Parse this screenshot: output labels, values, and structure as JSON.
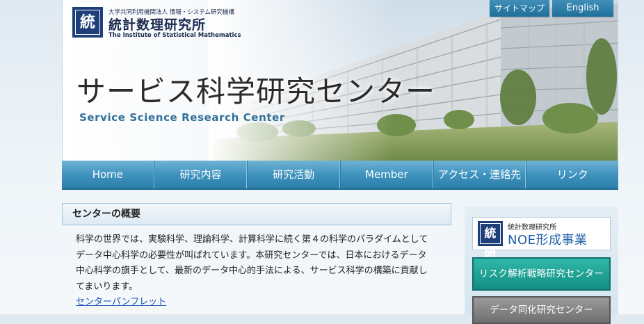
{
  "header": {
    "logo_mark": "統研",
    "logo_sub": "大学共同利用機関法人 情報・システム研究機構",
    "logo_name": "統計数理研究所",
    "logo_en": "The Institute of Statistical Mathematics",
    "title_jp": "サービス科学研究センター",
    "title_en": "Service Science Research Center"
  },
  "util_links": {
    "sitemap": "サイトマップ",
    "english": "English"
  },
  "nav": {
    "items": [
      "Home",
      "研究内容",
      "研究活動",
      "Member",
      "アクセス・連絡先",
      "リンク"
    ]
  },
  "main": {
    "section_title": "センターの概要",
    "body_lines": [
      "科学の世界では、実験科学、理論科学、計算科学に続く第４の科学のパラダイムとして",
      "データ中心科学の必要性が叫ばれています。本研究センターでは、日本におけるデータ",
      "中心科学の旗手として、最新のデータ中心的手法による、サービス科学の構築に貢献し",
      "てまいります。"
    ],
    "pamphlet_link": "センターパンフレット"
  },
  "sidebar": {
    "noe_sub": "統計数理研究所",
    "noe_main": "NOE形成事業",
    "risk": "リスク解析戦略研究センター",
    "data_assim": "データ同化研究センター"
  },
  "colors": {
    "nav": "#3f93bf",
    "title_en": "#2f6f98",
    "risk_banner": "#1fa394",
    "link": "#1a56b8",
    "logo": "#1f3f7a"
  }
}
